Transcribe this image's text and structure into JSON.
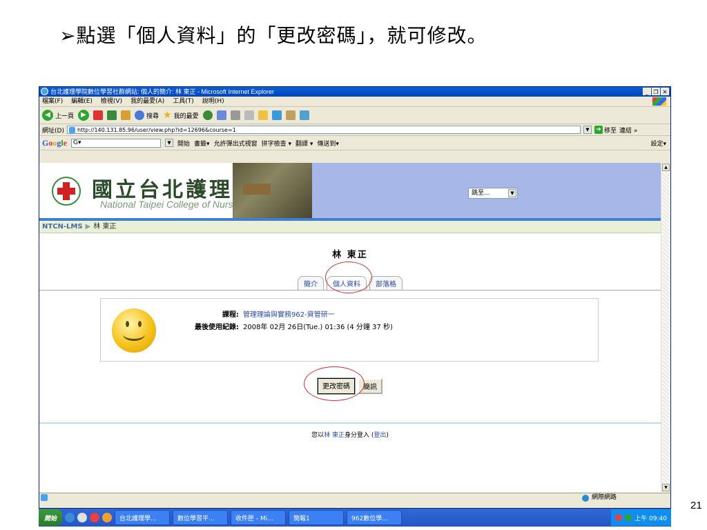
{
  "slide": {
    "title": "➢點選「個人資料」的「更改密碼」，就可修改。",
    "page_number": "21"
  },
  "window": {
    "title": "台北護理學院數位學習社群網站: 個人的簡介: 林 東正 - Microsoft Internet Explorer",
    "buttons": [
      "_",
      "❐",
      "✕"
    ]
  },
  "menu": [
    "檔案(F)",
    "編輯(E)",
    "檢視(V)",
    "我的最愛(A)",
    "工具(T)",
    "說明(H)"
  ],
  "toolbar": {
    "back": "上一頁",
    "search": "搜尋",
    "favorites": "我的最愛"
  },
  "address": {
    "label": "網址(D)",
    "url": "http://140.131.85.96/user/view.php?id=12696&course=1",
    "go": "移至",
    "links": "連結 »"
  },
  "google": {
    "logo": "Google",
    "search_prefix": "G▾",
    "items": [
      "開始",
      "書籤▾",
      "允許彈出式視窗",
      "拼字檢查 ▾",
      "翻譯 ▾",
      "傳送到▾"
    ],
    "settings": "設定▾"
  },
  "site": {
    "school_zh": "國立台北護理學院",
    "school_en": "National Taipei College of Nursing",
    "jump": "跳至...",
    "breadcrumb_root": "NTCN-LMS",
    "breadcrumb_current": "林 東正"
  },
  "profile": {
    "fullname": "林 東正",
    "tabs": [
      "簡介",
      "個人資料",
      "部落格"
    ],
    "active_tab": "個人資料",
    "course_label": "課程:",
    "course_value": "管理理論與實務962-資管研一",
    "last_access_label": "最後使用紀錄:",
    "last_access_value": "2008年 02月 26日(Tue.) 01:36  (4 分鐘 37 秒)",
    "change_password": "更改密碼",
    "message": "簡訊"
  },
  "footer": {
    "prefix": "您以",
    "user": "林 東正",
    "middle": "身分登入 (",
    "logout": "登出",
    "suffix": ")"
  },
  "status": {
    "zone": "網際網路"
  },
  "taskbar": {
    "start": "開始",
    "tasks": [
      "台北護理學...",
      "數位學習平...",
      "收件匣 - Mi...",
      "簡報1",
      "962數位學..."
    ],
    "clock": "上午 09:40"
  },
  "colors": {
    "title_blue": "#0443b9",
    "banner_blue": "#a7b7e7",
    "link_blue": "#2a4aaa",
    "annotation_red": "#d03030"
  }
}
